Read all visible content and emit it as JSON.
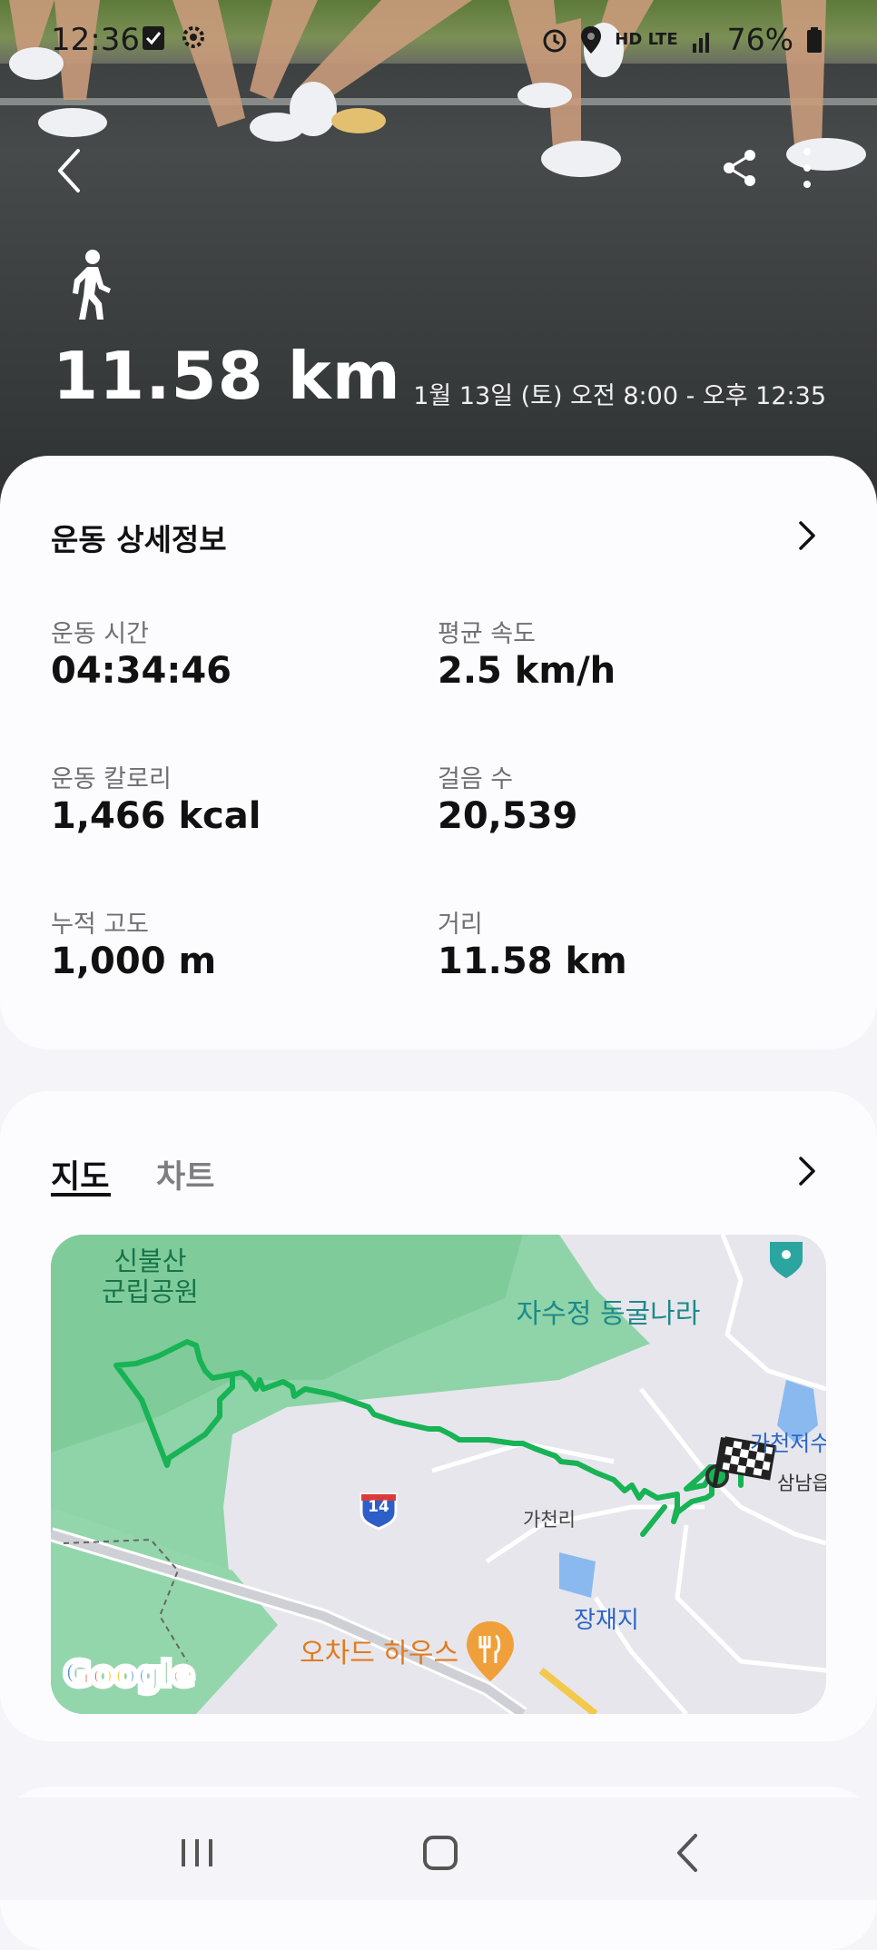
{
  "status_bar": {
    "time": "12:36",
    "network": "HD LTE",
    "battery": "76%"
  },
  "header": {
    "distance": "11.58 km",
    "datetime": "1월 13일 (토) 오전 8:00 - 오후 12:35",
    "activity_icon": "walk-icon"
  },
  "details": {
    "title": "운동 상세정보",
    "stats": [
      {
        "label": "운동 시간",
        "value": "04:34:46"
      },
      {
        "label": "평균 속도",
        "value": "2.5 km/h"
      },
      {
        "label": "운동 칼로리",
        "value": "1,466 kcal"
      },
      {
        "label": "걸음 수",
        "value": "20,539"
      },
      {
        "label": "누적 고도",
        "value": "1,000 m"
      },
      {
        "label": "거리",
        "value": "11.58 km"
      }
    ]
  },
  "map_section": {
    "tabs": [
      "지도",
      "차트"
    ],
    "active_tab": "지도",
    "labels": {
      "park": "신불산\n군립공원",
      "cave": "자수정 동굴나라",
      "reservoir": "가천저수",
      "town": "삼남읍",
      "village": "가천리",
      "pond": "장재지",
      "restaurant": "오차드 하우스",
      "route_shield": "14"
    },
    "attribution": "Google"
  },
  "colors": {
    "route": "#1db954",
    "card_bg": "#fcfcfe",
    "page_bg": "#f5f5f9"
  }
}
